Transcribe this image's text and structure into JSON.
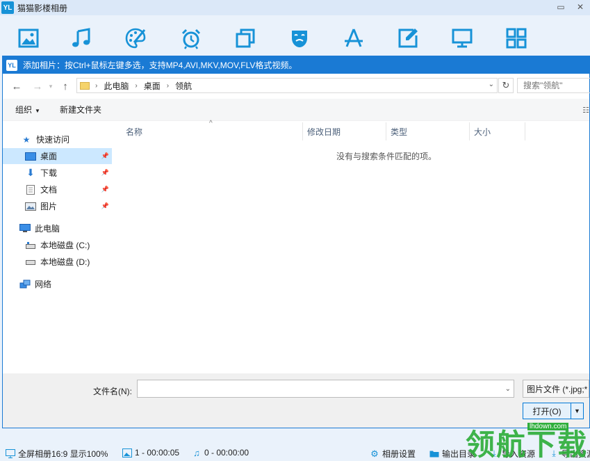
{
  "app": {
    "title": "猫猫影楼相册",
    "logo": "YL",
    "window_buttons": [
      "restore-icon",
      "close-icon"
    ]
  },
  "toolbar": {
    "icons": [
      "image-icon",
      "music-icon",
      "palette-icon",
      "alarm-clock-icon",
      "copy-icon",
      "theater-mask-icon",
      "app-store-icon",
      "edit-icon",
      "monitor-icon",
      "grid-icon"
    ],
    "accent": "#1792d7"
  },
  "dialog": {
    "logo": "YL",
    "title": "添加相片：按Ctrl+鼠标左键多选，支持MP4,AVI,MKV,MOV,FLV格式视频。",
    "breadcrumbs": [
      "此电脑",
      "桌面",
      "领航"
    ],
    "search_placeholder": "搜索\"领航\"",
    "commands": {
      "organize": "组织",
      "new_folder": "新建文件夹"
    },
    "sidebar": {
      "quick_access": "快速访问",
      "desktop": "桌面",
      "downloads": "下载",
      "documents": "文档",
      "pictures": "图片",
      "this_pc": "此电脑",
      "drive_c": "本地磁盘 (C:)",
      "drive_d": "本地磁盘 (D:)",
      "network": "网络"
    },
    "columns": {
      "name": "名称",
      "modified": "修改日期",
      "type": "类型",
      "size": "大小"
    },
    "empty_message": "没有与搜索条件匹配的项。",
    "filename_label": "文件名(N):",
    "filename_value": "",
    "file_type": "图片文件 (*.jpg;*",
    "open_button": "打开(O)"
  },
  "status": {
    "album": "全屏相册16:9 显示100%",
    "photos": "1 - 00:00:05",
    "music": "0 - 00:00:00",
    "settings": "相册设置",
    "export_dir": "输出目录",
    "import": "导入资源",
    "export": "导出资源"
  },
  "watermark": {
    "text": "领航下载",
    "domain": "lhdown.com"
  }
}
